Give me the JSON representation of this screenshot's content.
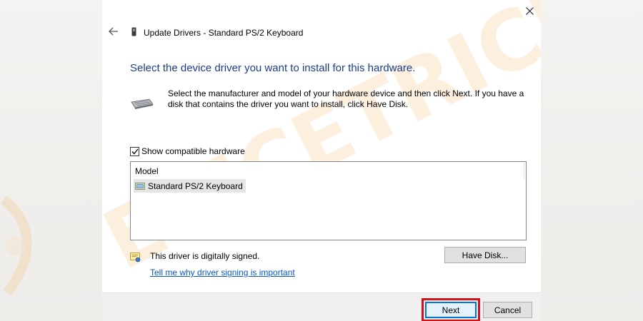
{
  "window": {
    "title": "Update Drivers - Standard PS/2 Keyboard",
    "close_icon": "close-icon",
    "back_icon": "back-arrow-icon"
  },
  "main": {
    "heading": "Select the device driver you want to install for this hardware.",
    "instructions": "Select the manufacturer and model of your hardware device and then click Next. If you have a disk that contains the driver you want to install, click Have Disk.",
    "show_compatible": {
      "label": "Show compatible hardware",
      "checked": true
    },
    "model_list": {
      "header": "Model",
      "items": [
        {
          "label": "Standard PS/2 Keyboard",
          "selected": true
        }
      ]
    },
    "signed_text": "This driver is digitally signed.",
    "signing_link": "Tell me why driver signing is important",
    "have_disk_label": "Have Disk..."
  },
  "footer": {
    "next_label": "Next",
    "cancel_label": "Cancel"
  },
  "colors": {
    "heading": "#1c3d8c",
    "link": "#0a57c4",
    "highlight": "#d0121b",
    "focus_border": "#0078d7",
    "watermark": "#f7d9b0"
  }
}
